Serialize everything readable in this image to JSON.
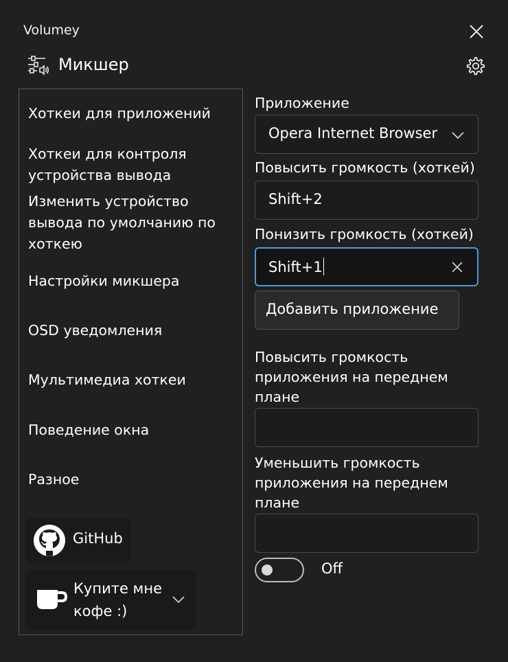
{
  "window": {
    "title": "Volumey"
  },
  "header": {
    "title": "Микшер"
  },
  "sidebar": {
    "items": [
      {
        "label": "Хоткеи для приложений"
      },
      {
        "label": "Хоткеи для контроля устройства вывода"
      },
      {
        "label": "Изменить устройство вывода по умолчанию по хоткею"
      },
      {
        "label": "Настройки микшера"
      },
      {
        "label": "OSD уведомления"
      },
      {
        "label": "Мультимедиа хоткеи"
      },
      {
        "label": "Поведение окна"
      },
      {
        "label": "Разное"
      }
    ],
    "github_label": "GitHub",
    "coffee_label": "Купите мне кофе :)"
  },
  "form": {
    "app_label": "Приложение",
    "app_value": "Opera Internet Browser",
    "up_label": "Повысить громкость (хоткей)",
    "up_value": "Shift+2",
    "down_label": "Понизить громкость (хоткей)",
    "down_value": "Shift+1",
    "add_button": "Добавить приложение",
    "fg_up_label": "Повысить громкость приложения на переднем плане",
    "fg_up_value": "",
    "fg_down_label": "Уменьшить громкость приложения на переднем плане",
    "fg_down_value": "",
    "toggle_state": "Off"
  },
  "icons": {
    "close": "close-icon",
    "mixer": "mixer-icon",
    "settings": "gear-icon",
    "github": "github-icon",
    "coffee": "coffee-cup-icon",
    "chevron": "chevron-down-icon",
    "clear": "clear-icon"
  },
  "colors": {
    "background": "#202020",
    "accent": "#4a9bd8",
    "field_bg": "#1c1c1c"
  }
}
